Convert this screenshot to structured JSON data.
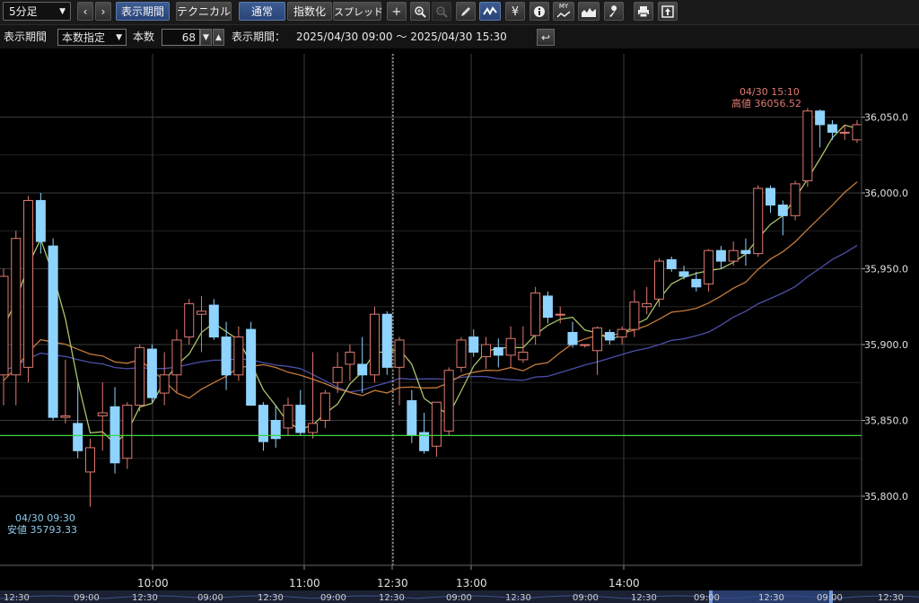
{
  "toolbar": {
    "interval": "5分足",
    "prev": "‹",
    "next": "›",
    "display_period": "表示期間",
    "technical": "テクニカル",
    "normal": "通常",
    "index": "指数化",
    "spread": "スプレッド",
    "crosshair_icon": "+",
    "yen_icon": "¥",
    "info_icon": "i",
    "my_label": "MY"
  },
  "settings": {
    "period_label": "表示期間",
    "period_mode": "本数指定",
    "count_label": "本数",
    "count_value": "68",
    "range_label": "表示期間：",
    "range_value": "2025/04/30 09:00 ～ 2025/04/30 15:30"
  },
  "colors": {
    "up": "#e07a70",
    "down": "#8fd3ff",
    "ma_short": "#a9c46a",
    "ma_mid": "#c47a3c",
    "ma_long": "#4b4fa8",
    "hline": "#3fd53f",
    "grid": "#3a3a3a"
  },
  "chart_data": {
    "type": "candlestick",
    "yticks": [
      "35,800.0",
      "35,850.0",
      "35,900.0",
      "35,950.0",
      "36,000.0",
      "36,050.0"
    ],
    "xticks": [
      "10:00",
      "11:00",
      "12:30",
      "13:00",
      "14:00"
    ],
    "ylim": [
      35760,
      36075
    ],
    "horizontal_line": 35840,
    "high_annotation": {
      "time": "04/30 15:10",
      "text": "高値 36056.52"
    },
    "low_annotation": {
      "time": "04/30 09:30",
      "text": "安値 35793.33"
    },
    "navigator_labels": [
      "12:30",
      "09:00",
      "12:30",
      "09:00",
      "12:30",
      "09:00",
      "12:30",
      "09:00",
      "12:30",
      "09:00",
      "12:30",
      "09:00",
      "12:30",
      "09:00",
      "12:30"
    ],
    "candles": [
      {
        "o": 35880,
        "h": 35950,
        "l": 35860,
        "c": 35945
      },
      {
        "o": 35880,
        "h": 35975,
        "l": 35860,
        "c": 35970
      },
      {
        "o": 35885,
        "h": 35998,
        "l": 35875,
        "c": 35995
      },
      {
        "o": 35995,
        "h": 36000,
        "l": 35960,
        "c": 35968
      },
      {
        "o": 35965,
        "h": 35970,
        "l": 35850,
        "c": 35852
      },
      {
        "o": 35852,
        "h": 35890,
        "l": 35848,
        "c": 35853
      },
      {
        "o": 35848,
        "h": 35875,
        "l": 35825,
        "c": 35830
      },
      {
        "o": 35816,
        "h": 35838,
        "l": 35793,
        "c": 35832
      },
      {
        "o": 35853,
        "h": 35875,
        "l": 35830,
        "c": 35855
      },
      {
        "o": 35859,
        "h": 35872,
        "l": 35815,
        "c": 35822
      },
      {
        "o": 35825,
        "h": 35862,
        "l": 35818,
        "c": 35860
      },
      {
        "o": 35860,
        "h": 35900,
        "l": 35856,
        "c": 35898
      },
      {
        "o": 35897,
        "h": 35900,
        "l": 35862,
        "c": 35865
      },
      {
        "o": 35868,
        "h": 35895,
        "l": 35860,
        "c": 35880
      },
      {
        "o": 35880,
        "h": 35910,
        "l": 35868,
        "c": 35903
      },
      {
        "o": 35905,
        "h": 35930,
        "l": 35900,
        "c": 35927
      },
      {
        "o": 35920,
        "h": 35932,
        "l": 35895,
        "c": 35922
      },
      {
        "o": 35926,
        "h": 35930,
        "l": 35903,
        "c": 35905
      },
      {
        "o": 35905,
        "h": 35915,
        "l": 35870,
        "c": 35880
      },
      {
        "o": 35880,
        "h": 35912,
        "l": 35876,
        "c": 35905
      },
      {
        "o": 35910,
        "h": 35915,
        "l": 35860,
        "c": 35860
      },
      {
        "o": 35860,
        "h": 35862,
        "l": 35830,
        "c": 35836
      },
      {
        "o": 35850,
        "h": 35860,
        "l": 35832,
        "c": 35838
      },
      {
        "o": 35845,
        "h": 35865,
        "l": 35840,
        "c": 35860
      },
      {
        "o": 35860,
        "h": 35870,
        "l": 35840,
        "c": 35842
      },
      {
        "o": 35842,
        "h": 35895,
        "l": 35838,
        "c": 35848
      },
      {
        "o": 35850,
        "h": 35870,
        "l": 35845,
        "c": 35868
      },
      {
        "o": 35875,
        "h": 35895,
        "l": 35868,
        "c": 35885
      },
      {
        "o": 35887,
        "h": 35900,
        "l": 35876,
        "c": 35895
      },
      {
        "o": 35887,
        "h": 35905,
        "l": 35868,
        "c": 35880
      },
      {
        "o": 35880,
        "h": 35925,
        "l": 35875,
        "c": 35920
      },
      {
        "o": 35920,
        "h": 35922,
        "l": 35880,
        "c": 35885
      },
      {
        "o": 35885,
        "h": 35905,
        "l": 35860,
        "c": 35903
      },
      {
        "o": 35863,
        "h": 35870,
        "l": 35835,
        "c": 35840
      },
      {
        "o": 35842,
        "h": 35855,
        "l": 35828,
        "c": 35830
      },
      {
        "o": 35833,
        "h": 35862,
        "l": 35826,
        "c": 35862
      },
      {
        "o": 35843,
        "h": 35885,
        "l": 35840,
        "c": 35883
      },
      {
        "o": 35885,
        "h": 35905,
        "l": 35882,
        "c": 35903
      },
      {
        "o": 35905,
        "h": 35910,
        "l": 35892,
        "c": 35895
      },
      {
        "o": 35892,
        "h": 35905,
        "l": 35884,
        "c": 35900
      },
      {
        "o": 35898,
        "h": 35904,
        "l": 35885,
        "c": 35893
      },
      {
        "o": 35893,
        "h": 35912,
        "l": 35885,
        "c": 35904
      },
      {
        "o": 35890,
        "h": 35912,
        "l": 35888,
        "c": 35895
      },
      {
        "o": 35906,
        "h": 35938,
        "l": 35900,
        "c": 35934
      },
      {
        "o": 35932,
        "h": 35935,
        "l": 35914,
        "c": 35918
      },
      {
        "o": 35920,
        "h": 35925,
        "l": 35914,
        "c": 35920
      },
      {
        "o": 35908,
        "h": 35915,
        "l": 35898,
        "c": 35900
      },
      {
        "o": 35900,
        "h": 35900,
        "l": 35898,
        "c": 35900
      },
      {
        "o": 35896,
        "h": 35912,
        "l": 35880,
        "c": 35911
      },
      {
        "o": 35908,
        "h": 35910,
        "l": 35900,
        "c": 35903
      },
      {
        "o": 35905,
        "h": 35912,
        "l": 35900,
        "c": 35910
      },
      {
        "o": 35910,
        "h": 35936,
        "l": 35905,
        "c": 35928
      },
      {
        "o": 35925,
        "h": 35938,
        "l": 35920,
        "c": 35927
      },
      {
        "o": 35930,
        "h": 35957,
        "l": 35925,
        "c": 35955
      },
      {
        "o": 35956,
        "h": 35958,
        "l": 35948,
        "c": 35950
      },
      {
        "o": 35948,
        "h": 35952,
        "l": 35943,
        "c": 35945
      },
      {
        "o": 35943,
        "h": 35948,
        "l": 35935,
        "c": 35938
      },
      {
        "o": 35940,
        "h": 35963,
        "l": 35935,
        "c": 35962
      },
      {
        "o": 35962,
        "h": 35965,
        "l": 35950,
        "c": 35955
      },
      {
        "o": 35955,
        "h": 35968,
        "l": 35952,
        "c": 35962
      },
      {
        "o": 35962,
        "h": 35970,
        "l": 35952,
        "c": 35960
      },
      {
        "o": 35960,
        "h": 36005,
        "l": 35958,
        "c": 36003
      },
      {
        "o": 36003,
        "h": 36005,
        "l": 35987,
        "c": 35992
      },
      {
        "o": 35992,
        "h": 35995,
        "l": 35972,
        "c": 35985
      },
      {
        "o": 35985,
        "h": 36008,
        "l": 35982,
        "c": 36006
      },
      {
        "o": 36008,
        "h": 36056,
        "l": 36004,
        "c": 36054
      },
      {
        "o": 36054,
        "h": 36055,
        "l": 36030,
        "c": 36045
      },
      {
        "o": 36045,
        "h": 36048,
        "l": 36035,
        "c": 36040
      },
      {
        "o": 36040,
        "h": 36045,
        "l": 36035,
        "c": 36040
      },
      {
        "o": 36035,
        "h": 36048,
        "l": 36033,
        "c": 36045
      }
    ]
  }
}
